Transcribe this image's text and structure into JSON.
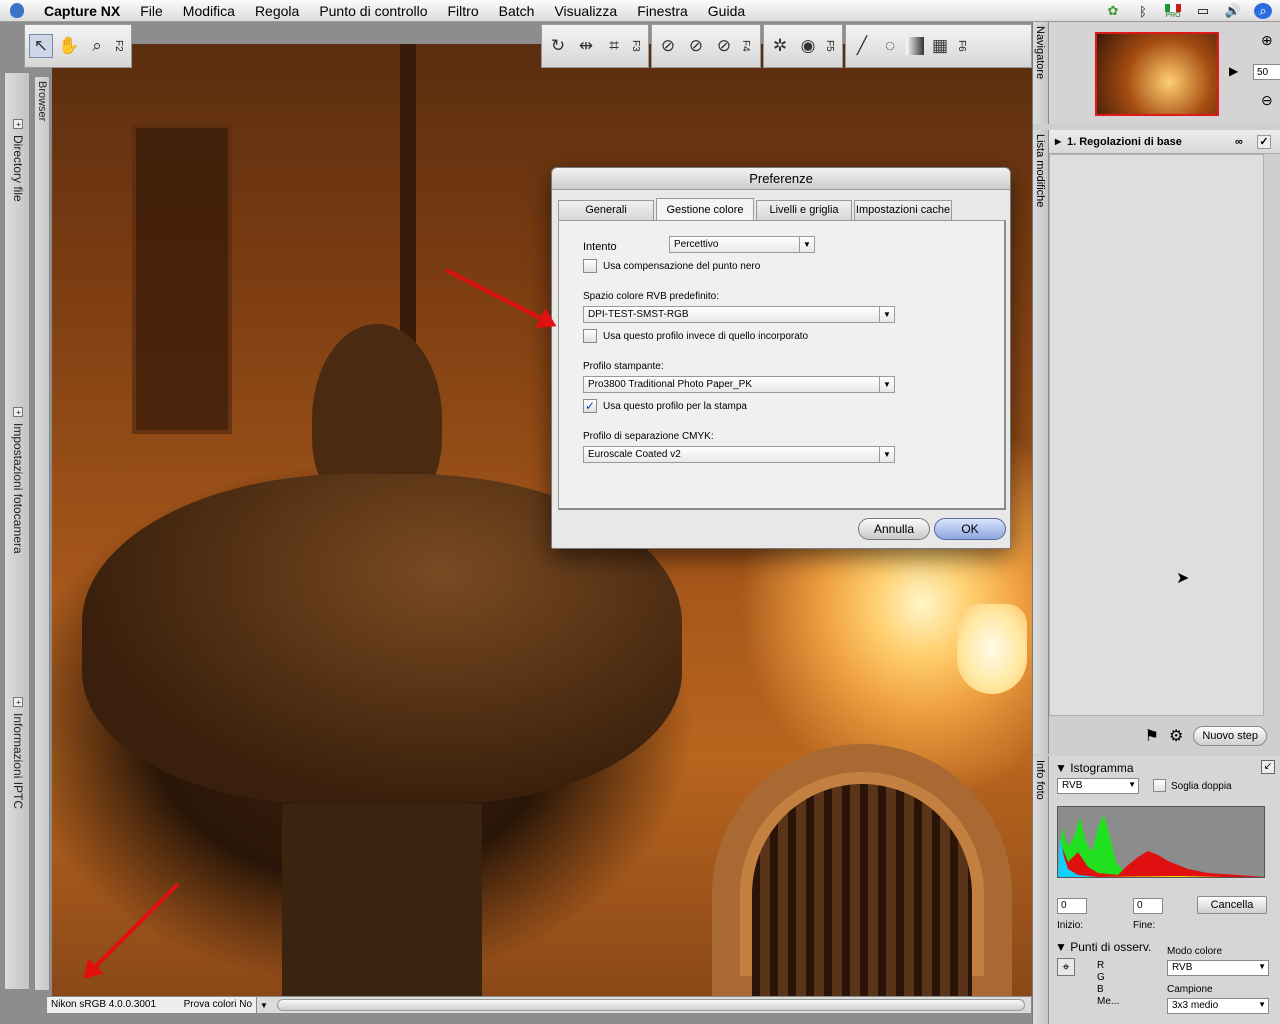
{
  "menubar": {
    "app_name": "Capture NX",
    "items": [
      "File",
      "Modifica",
      "Regola",
      "Punto di controllo",
      "Filtro",
      "Batch",
      "Visualizza",
      "Finestra",
      "Guida"
    ],
    "status_badge": "PRO"
  },
  "toolbar": {
    "fkeys": [
      "F2",
      "F3",
      "F4",
      "F5",
      "F6"
    ],
    "icons": [
      "arrow-icon",
      "hand-icon",
      "zoom-icon",
      "rotate-icon",
      "straighten-icon",
      "crop-icon",
      "black-point-icon",
      "white-point-icon",
      "neutral-point-icon",
      "color-point-icon",
      "selection-control-icon",
      "red-eye-icon",
      "brush-icon",
      "lasso-icon",
      "gradient-icon",
      "fill-icon"
    ]
  },
  "left_sidebar": {
    "browser_label": "Browser",
    "tabs": [
      "Directory file",
      "Impostazioni fotocamera",
      "Informazioni IPTC"
    ]
  },
  "status_bar": {
    "profile": "Nikon sRGB 4.0.0.3001",
    "proof": "Prova colori No"
  },
  "right_panel": {
    "navigator_label": "Navigatore",
    "zoom_value": "50",
    "zoom_unit": "%",
    "edit_list_label": "Lista modifiche",
    "step_title": "1. Regolazioni di base",
    "new_step_button": "Nuovo step",
    "photo_info_label": "Info foto",
    "histogram": {
      "title": "Istogramma",
      "channel": "RVB",
      "double_threshold": "Soglia doppia",
      "start_value": "0",
      "end_value": "0",
      "start_label": "Inizio:",
      "end_label": "Fine:",
      "cancel_button": "Cancella"
    },
    "watch_points": {
      "title": "Punti di osserv.",
      "channels": [
        "R",
        "G",
        "B",
        "Me..."
      ],
      "color_mode_label": "Modo colore",
      "color_mode": "RVB",
      "sample_label": "Campione",
      "sample": "3x3 medio"
    }
  },
  "dialog": {
    "title": "Preferenze",
    "tabs": [
      "Generali",
      "Gestione colore",
      "Livelli e griglia",
      "Impostazioni cache"
    ],
    "active_tab": "Gestione colore",
    "intent_label": "Intento",
    "intent_value": "Percettivo",
    "black_point_label": "Usa compensazione del punto nero",
    "black_point_checked": false,
    "rgb_space_label": "Spazio colore RVB predefinito:",
    "rgb_space_value": "DPI-TEST-SMST-RGB",
    "use_profile_label": "Usa questo profilo invece di quello incorporato",
    "use_profile_checked": false,
    "printer_label": "Profilo stampante:",
    "printer_value": "Pro3800 Traditional Photo Paper_PK",
    "use_print_label": "Usa questo profilo per la stampa",
    "use_print_checked": true,
    "cmyk_label": "Profilo di separazione CMYK:",
    "cmyk_value": "Euroscale Coated v2",
    "cancel_button": "Annulla",
    "ok_button": "OK"
  },
  "colors": {
    "annotation_arrow": "#e01010",
    "ok_button": "#8ea6e0",
    "selection_frame": "#e01a1a"
  }
}
